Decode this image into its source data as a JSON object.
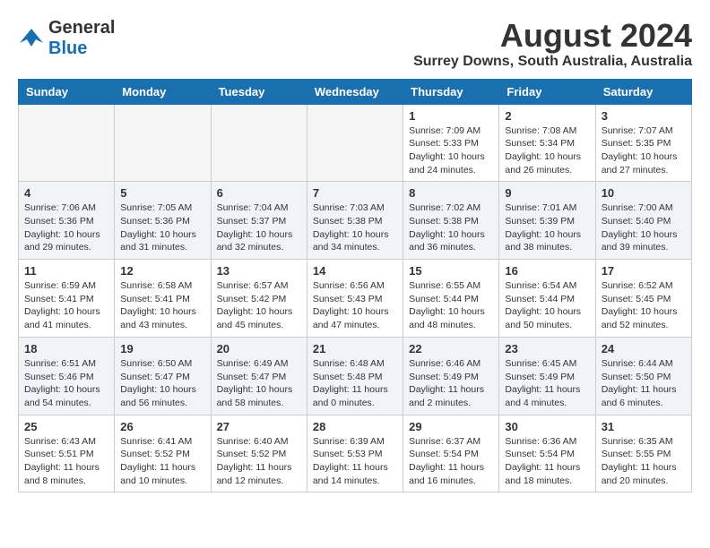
{
  "header": {
    "logo_general": "General",
    "logo_blue": "Blue",
    "title": "August 2024",
    "subtitle": "Surrey Downs, South Australia, Australia"
  },
  "weekdays": [
    "Sunday",
    "Monday",
    "Tuesday",
    "Wednesday",
    "Thursday",
    "Friday",
    "Saturday"
  ],
  "weeks": [
    [
      {
        "day": "",
        "empty": true
      },
      {
        "day": "",
        "empty": true
      },
      {
        "day": "",
        "empty": true
      },
      {
        "day": "",
        "empty": true
      },
      {
        "day": "1",
        "sunrise": "Sunrise: 7:09 AM",
        "sunset": "Sunset: 5:33 PM",
        "daylight": "Daylight: 10 hours and 24 minutes."
      },
      {
        "day": "2",
        "sunrise": "Sunrise: 7:08 AM",
        "sunset": "Sunset: 5:34 PM",
        "daylight": "Daylight: 10 hours and 26 minutes."
      },
      {
        "day": "3",
        "sunrise": "Sunrise: 7:07 AM",
        "sunset": "Sunset: 5:35 PM",
        "daylight": "Daylight: 10 hours and 27 minutes."
      }
    ],
    [
      {
        "day": "4",
        "sunrise": "Sunrise: 7:06 AM",
        "sunset": "Sunset: 5:36 PM",
        "daylight": "Daylight: 10 hours and 29 minutes."
      },
      {
        "day": "5",
        "sunrise": "Sunrise: 7:05 AM",
        "sunset": "Sunset: 5:36 PM",
        "daylight": "Daylight: 10 hours and 31 minutes."
      },
      {
        "day": "6",
        "sunrise": "Sunrise: 7:04 AM",
        "sunset": "Sunset: 5:37 PM",
        "daylight": "Daylight: 10 hours and 32 minutes."
      },
      {
        "day": "7",
        "sunrise": "Sunrise: 7:03 AM",
        "sunset": "Sunset: 5:38 PM",
        "daylight": "Daylight: 10 hours and 34 minutes."
      },
      {
        "day": "8",
        "sunrise": "Sunrise: 7:02 AM",
        "sunset": "Sunset: 5:38 PM",
        "daylight": "Daylight: 10 hours and 36 minutes."
      },
      {
        "day": "9",
        "sunrise": "Sunrise: 7:01 AM",
        "sunset": "Sunset: 5:39 PM",
        "daylight": "Daylight: 10 hours and 38 minutes."
      },
      {
        "day": "10",
        "sunrise": "Sunrise: 7:00 AM",
        "sunset": "Sunset: 5:40 PM",
        "daylight": "Daylight: 10 hours and 39 minutes."
      }
    ],
    [
      {
        "day": "11",
        "sunrise": "Sunrise: 6:59 AM",
        "sunset": "Sunset: 5:41 PM",
        "daylight": "Daylight: 10 hours and 41 minutes."
      },
      {
        "day": "12",
        "sunrise": "Sunrise: 6:58 AM",
        "sunset": "Sunset: 5:41 PM",
        "daylight": "Daylight: 10 hours and 43 minutes."
      },
      {
        "day": "13",
        "sunrise": "Sunrise: 6:57 AM",
        "sunset": "Sunset: 5:42 PM",
        "daylight": "Daylight: 10 hours and 45 minutes."
      },
      {
        "day": "14",
        "sunrise": "Sunrise: 6:56 AM",
        "sunset": "Sunset: 5:43 PM",
        "daylight": "Daylight: 10 hours and 47 minutes."
      },
      {
        "day": "15",
        "sunrise": "Sunrise: 6:55 AM",
        "sunset": "Sunset: 5:44 PM",
        "daylight": "Daylight: 10 hours and 48 minutes."
      },
      {
        "day": "16",
        "sunrise": "Sunrise: 6:54 AM",
        "sunset": "Sunset: 5:44 PM",
        "daylight": "Daylight: 10 hours and 50 minutes."
      },
      {
        "day": "17",
        "sunrise": "Sunrise: 6:52 AM",
        "sunset": "Sunset: 5:45 PM",
        "daylight": "Daylight: 10 hours and 52 minutes."
      }
    ],
    [
      {
        "day": "18",
        "sunrise": "Sunrise: 6:51 AM",
        "sunset": "Sunset: 5:46 PM",
        "daylight": "Daylight: 10 hours and 54 minutes."
      },
      {
        "day": "19",
        "sunrise": "Sunrise: 6:50 AM",
        "sunset": "Sunset: 5:47 PM",
        "daylight": "Daylight: 10 hours and 56 minutes."
      },
      {
        "day": "20",
        "sunrise": "Sunrise: 6:49 AM",
        "sunset": "Sunset: 5:47 PM",
        "daylight": "Daylight: 10 hours and 58 minutes."
      },
      {
        "day": "21",
        "sunrise": "Sunrise: 6:48 AM",
        "sunset": "Sunset: 5:48 PM",
        "daylight": "Daylight: 11 hours and 0 minutes."
      },
      {
        "day": "22",
        "sunrise": "Sunrise: 6:46 AM",
        "sunset": "Sunset: 5:49 PM",
        "daylight": "Daylight: 11 hours and 2 minutes."
      },
      {
        "day": "23",
        "sunrise": "Sunrise: 6:45 AM",
        "sunset": "Sunset: 5:49 PM",
        "daylight": "Daylight: 11 hours and 4 minutes."
      },
      {
        "day": "24",
        "sunrise": "Sunrise: 6:44 AM",
        "sunset": "Sunset: 5:50 PM",
        "daylight": "Daylight: 11 hours and 6 minutes."
      }
    ],
    [
      {
        "day": "25",
        "sunrise": "Sunrise: 6:43 AM",
        "sunset": "Sunset: 5:51 PM",
        "daylight": "Daylight: 11 hours and 8 minutes."
      },
      {
        "day": "26",
        "sunrise": "Sunrise: 6:41 AM",
        "sunset": "Sunset: 5:52 PM",
        "daylight": "Daylight: 11 hours and 10 minutes."
      },
      {
        "day": "27",
        "sunrise": "Sunrise: 6:40 AM",
        "sunset": "Sunset: 5:52 PM",
        "daylight": "Daylight: 11 hours and 12 minutes."
      },
      {
        "day": "28",
        "sunrise": "Sunrise: 6:39 AM",
        "sunset": "Sunset: 5:53 PM",
        "daylight": "Daylight: 11 hours and 14 minutes."
      },
      {
        "day": "29",
        "sunrise": "Sunrise: 6:37 AM",
        "sunset": "Sunset: 5:54 PM",
        "daylight": "Daylight: 11 hours and 16 minutes."
      },
      {
        "day": "30",
        "sunrise": "Sunrise: 6:36 AM",
        "sunset": "Sunset: 5:54 PM",
        "daylight": "Daylight: 11 hours and 18 minutes."
      },
      {
        "day": "31",
        "sunrise": "Sunrise: 6:35 AM",
        "sunset": "Sunset: 5:55 PM",
        "daylight": "Daylight: 11 hours and 20 minutes."
      }
    ]
  ]
}
